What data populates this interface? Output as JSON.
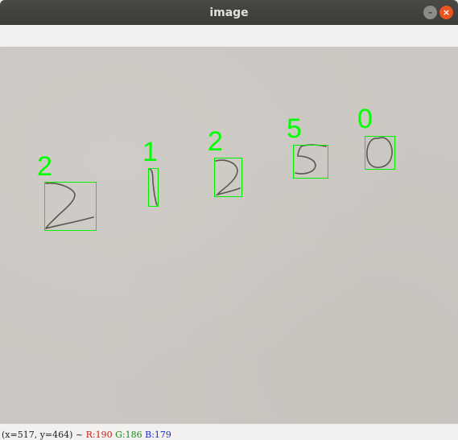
{
  "window": {
    "title": "image",
    "minimize_glyph": "–",
    "close_glyph": "×"
  },
  "detections": [
    {
      "label": "2"
    },
    {
      "label": "1"
    },
    {
      "label": "2"
    },
    {
      "label": "5"
    },
    {
      "label": "0"
    }
  ],
  "status": {
    "coords": "(x=517, y=464) ~",
    "r": "R:190",
    "g": "G:186",
    "b": "B:179"
  },
  "colors": {
    "box": "#00ee00",
    "label": "#00ff00",
    "ink": "#5a5650"
  }
}
